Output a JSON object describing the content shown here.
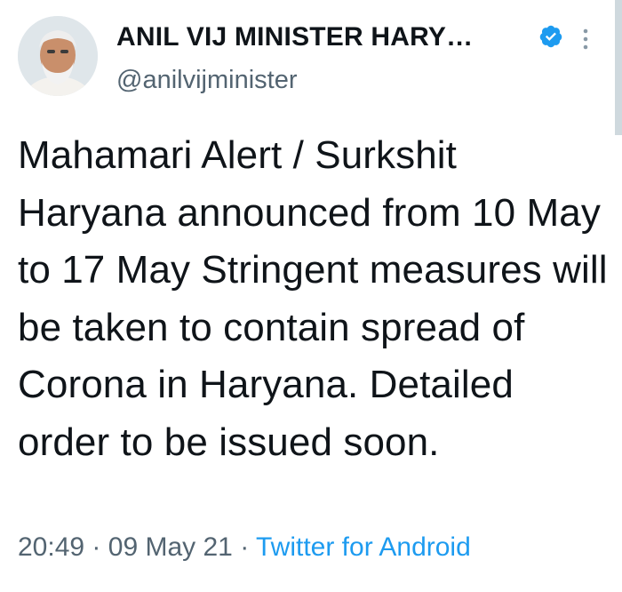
{
  "author": {
    "name": "ANIL VIJ MINISTER HARY…",
    "handle": "@anilvijminister",
    "avatar_icon": "profile-photo",
    "verified_icon": "verified-badge-icon",
    "more_icon": "more-options-icon"
  },
  "tweet": {
    "text": "Mahamari Alert / Surkshit Haryana announced from 10 May to 17 May Stringent measures will be taken to contain spread of Corona in Haryana. Detailed order to be issued soon.",
    "time": "20:49",
    "separator": "·",
    "date": "09 May 21",
    "source": "Twitter for Android"
  },
  "colors": {
    "text_primary": "#0f1419",
    "text_secondary": "#536471",
    "accent": "#1d9bf0"
  }
}
